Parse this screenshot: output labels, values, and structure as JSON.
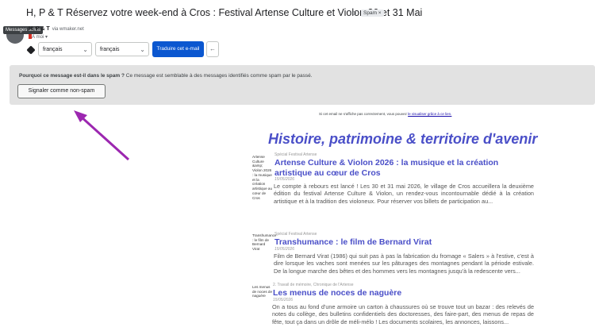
{
  "email": {
    "subject": "H, P & T Réservez votre week-end à Cros : Festival Artense Culture et Violon 30 et 31 Mai",
    "spam_label": "Spam ×",
    "sender_name": "H, P & T",
    "sender_addr": "via wmaker.net",
    "to_me": "À moi ▾",
    "tooltip": "Messages suivis"
  },
  "translate": {
    "from_lang": "français",
    "to_lang": "français",
    "button_label": "Traduire cet e-mail"
  },
  "spam_notice": {
    "question": "Pourquoi ce message est-il dans le spam ?",
    "explanation": "Ce message est semblable à des messages identifiés comme spam par le passé.",
    "button_label": "Signaler comme non-spam"
  },
  "newsletter": {
    "browser_text": "Si cet email ne s'affiche pas correctement, vous pouvez",
    "browser_link": "le visualiser grâce à ce lien.",
    "heading": "Histoire, patrimoine & territoire d'avenir",
    "articles": [
      {
        "thumb_alt": "Artense Culture &amp; Violon 2026 : la musique et la création artistique au cœur de Cros",
        "kicker": "Spécial Festival Artense",
        "title": "Artense Culture & Violon 2026 : la musique et la création artistique au cœur de Cros",
        "date": "15/05/2026",
        "excerpt": "Le compte à rebours est lancé ! Les 30 et 31 mai 2026, le village de Cros accueillera la deuxième édition du festival Artense Culture & Violon, un rendez-vous incontournable dédié à la création artistique et à la tradition des violoneux. Pour réserver vos billets de participation au..."
      },
      {
        "thumb_alt": "Transhumance : le film de Bernard Virat",
        "kicker": "Spécial Festival Artense",
        "title": "Transhumance : le film de Bernard Virat",
        "date": "15/05/2026",
        "excerpt": "Film de Bernard Virat (1986) qui suit pas à pas la fabrication du fromage « Salers » à l'estive, c'est à dire lorsque les vaches sont menées sur les pâturages des montagnes pendant la période estivale.   De la longue marche des bêtes et des hommes vers les montagnes jusqu'à la redescente vers..."
      },
      {
        "thumb_alt": "Les menus de noces de naguère",
        "kicker": "2. Travail de mémoire, Chronique de l'Artense",
        "title": "Les menus de noces de naguère",
        "date": "15/05/2026",
        "excerpt": "On a tous au fond d'une armoire un carton à chaussures où se trouve tout un bazar : des relevés de notes du collège, des bulletins confidentiels des doctoresses, des faire-part, des menus de repas de fête, tout ça dans un drôle de méli-mélo ! Les documents scolaires, les annonces, laissons..."
      }
    ]
  },
  "colors": {
    "accent": "#4a4fc8",
    "button_blue": "#0b57d0",
    "annotation_arrow": "#9c27b0"
  }
}
